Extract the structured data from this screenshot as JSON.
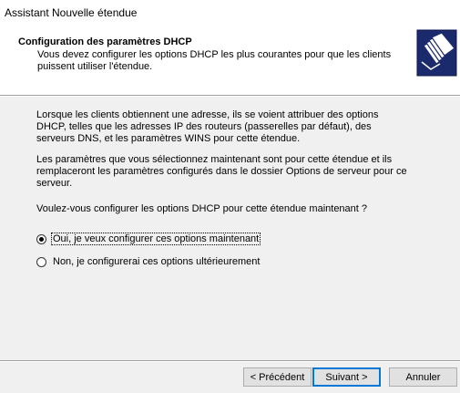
{
  "window": {
    "title": "Assistant Nouvelle étendue"
  },
  "header": {
    "title": "Configuration des paramètres DHCP",
    "subtitle": "Vous devez configurer les options DHCP les plus courantes pour que les clients puissent utiliser l'étendue.",
    "icon": "folders-icon"
  },
  "content": {
    "paragraph1": "Lorsque les clients obtiennent une adresse, ils se voient attribuer des options DHCP, telles que les adresses IP des routeurs (passerelles par défaut), des serveurs DNS, et les paramètres WINS pour cette étendue.",
    "paragraph2": "Les paramètres que vous sélectionnez maintenant sont pour cette étendue et ils remplaceront les paramètres configurés dans le dossier Options de serveur pour ce serveur.",
    "question": "Voulez-vous configurer les options DHCP pour cette étendue maintenant ?",
    "options": [
      {
        "label": "Oui, je veux configurer ces options maintenant",
        "selected": true
      },
      {
        "label": "Non, je configurerai ces options ultérieurement",
        "selected": false
      }
    ]
  },
  "buttons": {
    "back": "< Précédent",
    "next": "Suivant >",
    "cancel": "Annuler"
  }
}
